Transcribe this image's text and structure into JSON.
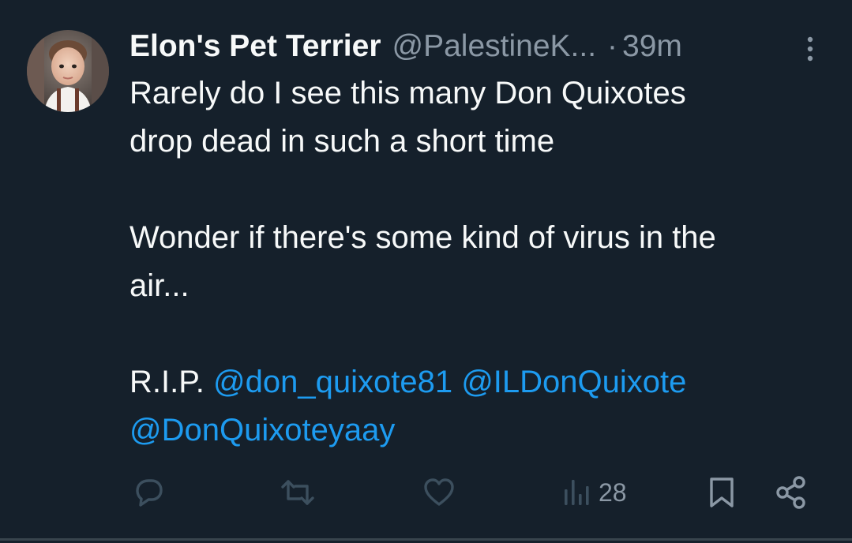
{
  "tweet": {
    "author_name": "Elon's Pet Terrier",
    "author_handle": "@PalestineK...",
    "separator": "·",
    "time_ago": "39m",
    "text_lines": [
      "Rarely do I see this many Don Quixotes",
      "drop dead in such a short time",
      "",
      "Wonder if there's some kind of virus in the",
      "air..."
    ],
    "rip_prefix": "R.I.P.",
    "mentions": [
      "@don_quixote81",
      "@ILDonQuixote",
      "@DonQuixoteyaay"
    ]
  },
  "actions": {
    "reply_icon": "reply-icon",
    "retweet_icon": "retweet-icon",
    "like_icon": "heart-icon",
    "views_icon": "views-bar-chart-icon",
    "views_count": "28",
    "bookmark_icon": "bookmark-icon",
    "share_icon": "share-icon"
  },
  "colors": {
    "background": "#15202b",
    "primary_text": "#f7f9f9",
    "secondary_text": "#8b98a5",
    "link": "#1d9bf0",
    "action_icon_faded": "#3c4f5e",
    "action_icon": "#8b98a5"
  }
}
